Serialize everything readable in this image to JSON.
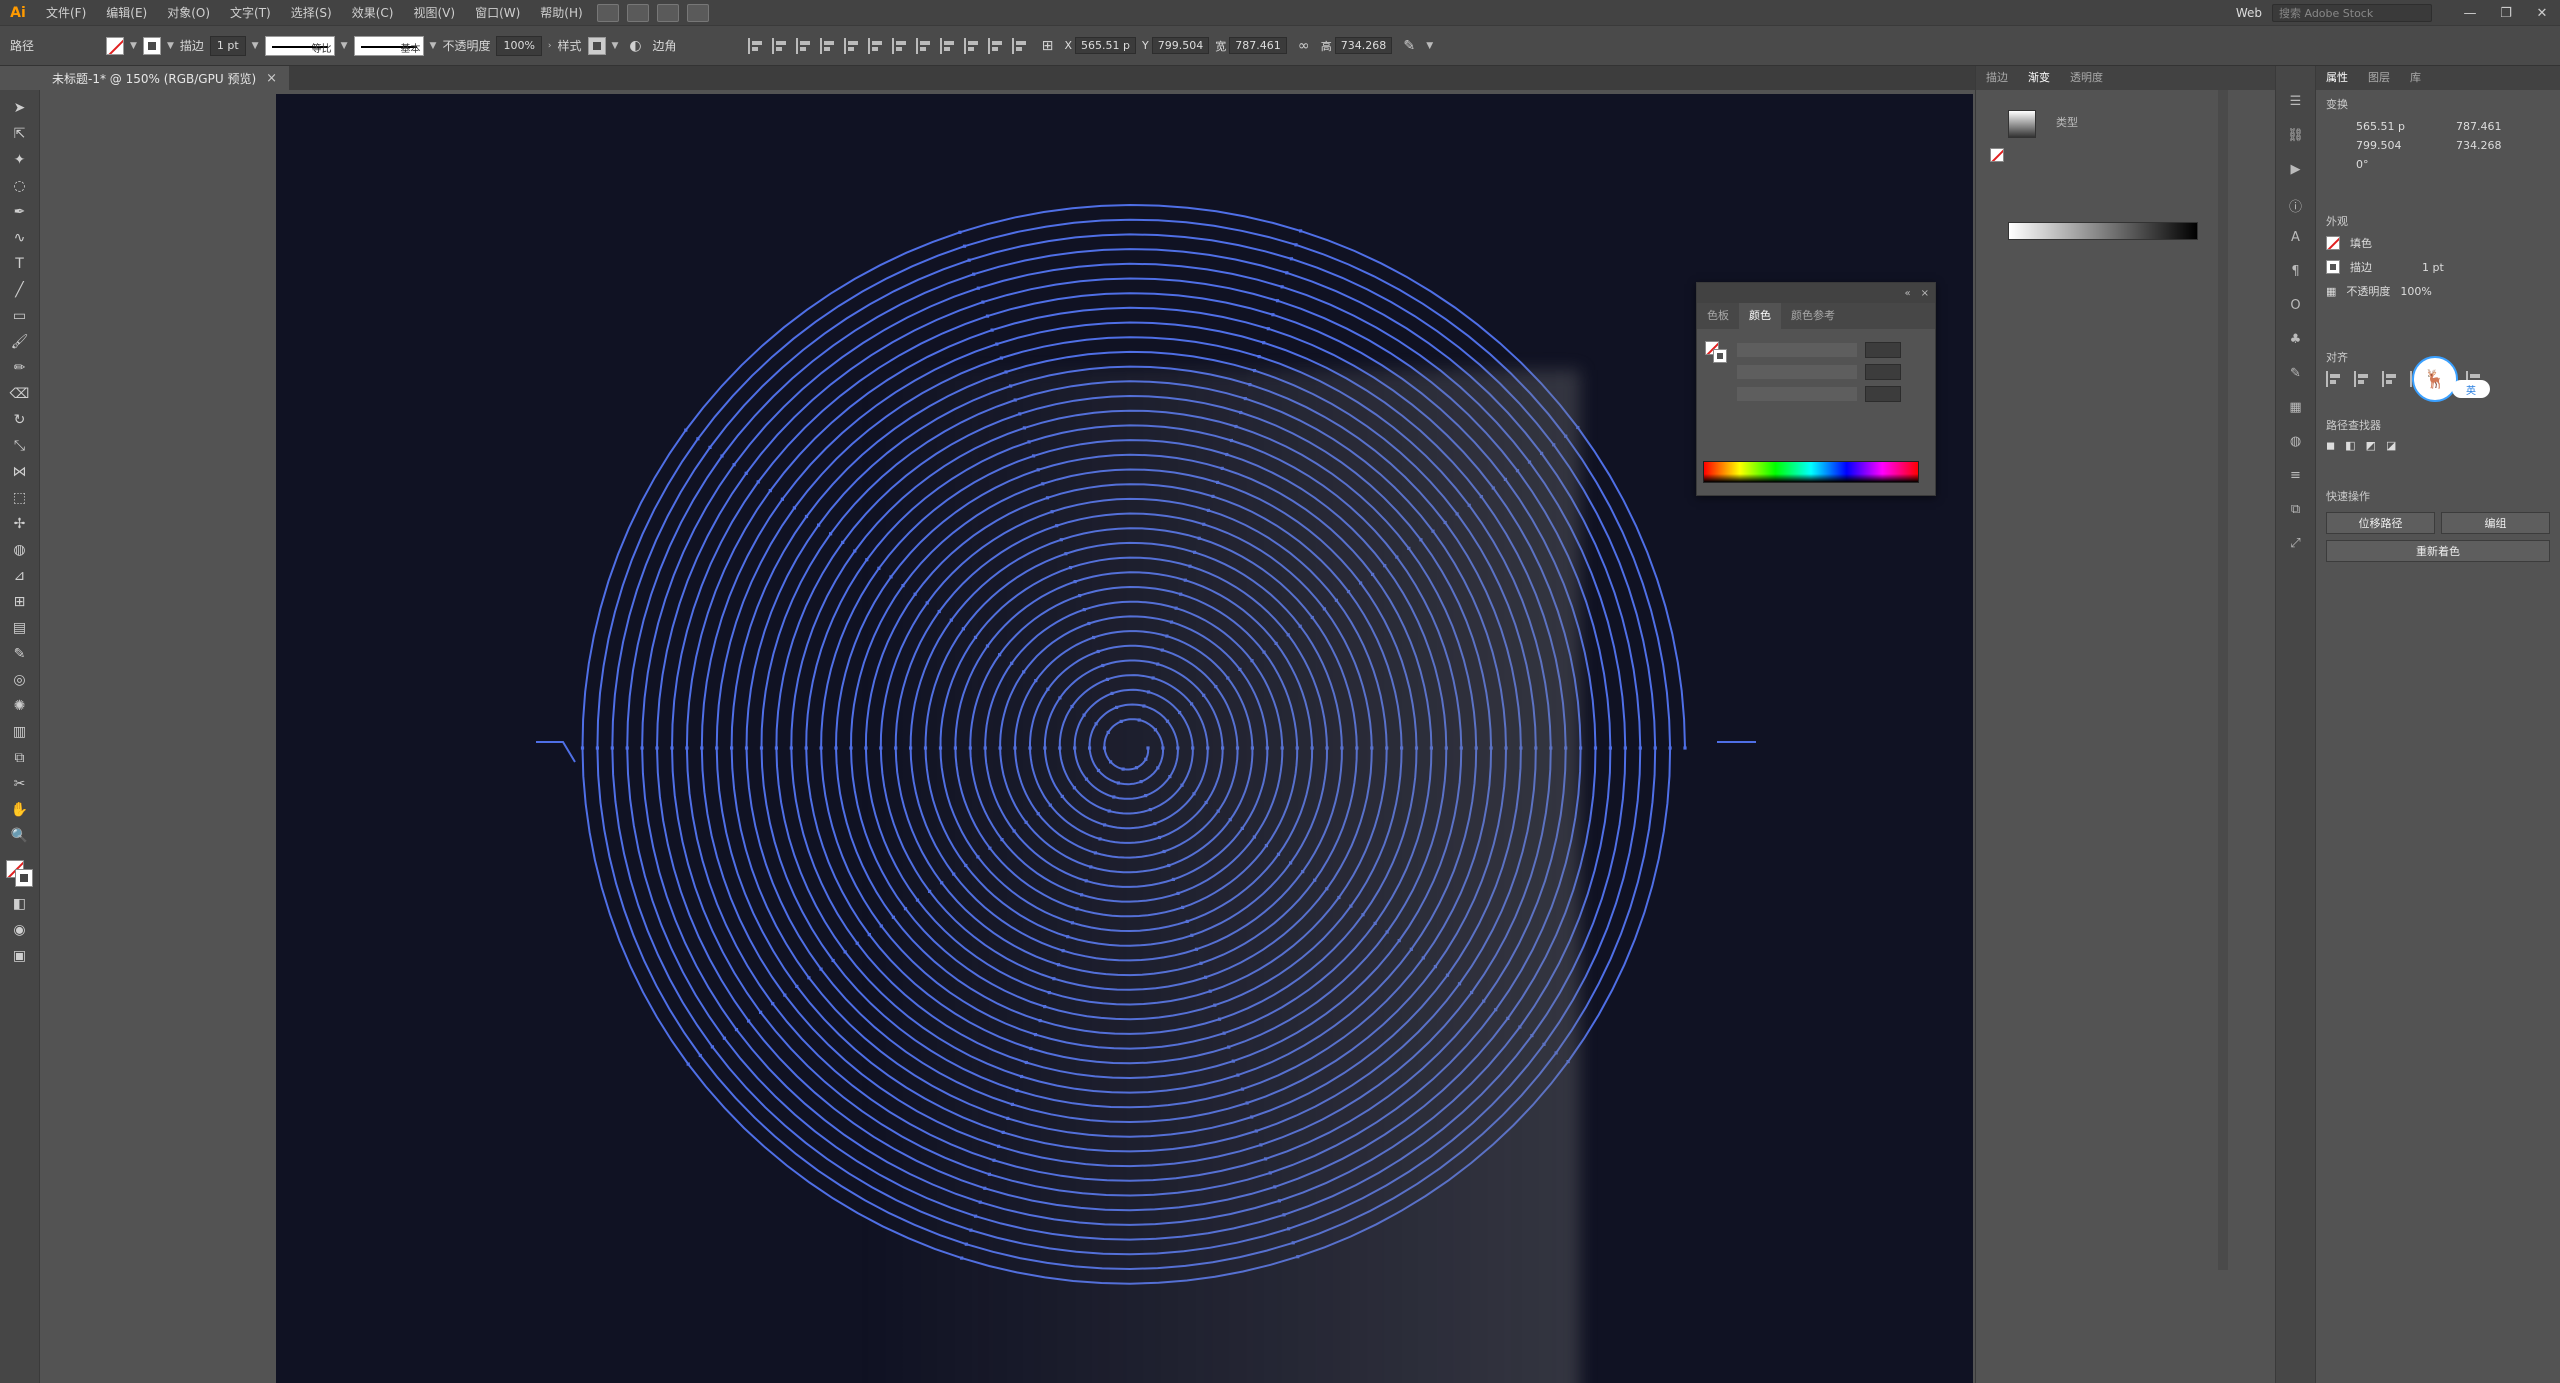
{
  "app": {
    "logo": "Ai"
  },
  "menu": {
    "items": [
      "文件(F)",
      "编辑(E)",
      "对象(O)",
      "文字(T)",
      "选择(S)",
      "效果(C)",
      "视图(V)",
      "窗口(W)",
      "帮助(H)"
    ],
    "workspace": "Web",
    "search_placeholder": "搜索 Adobe Stock"
  },
  "control_bar": {
    "path_label": "路径",
    "stroke_label": "描边",
    "stroke_weight": "1 pt",
    "profile_label": "等比",
    "brush_label": "基本",
    "opacity_label": "不透明度",
    "opacity_value": "100%",
    "style_label": "样式",
    "corner_label": "边角",
    "x_label": "X",
    "x_value": "565.51 p",
    "y_label": "Y",
    "y_value": "799.504",
    "w_label": "宽",
    "w_value": "787.461",
    "h_label": "高",
    "h_value": "734.268"
  },
  "document_tab": {
    "title": "未标题-1* @ 150% (RGB/GPU 预览)",
    "close": "×"
  },
  "color_panel": {
    "tabs": [
      "色板",
      "颜色",
      "颜色参考"
    ],
    "active_tab": "颜色",
    "header_buttons": [
      "«",
      "×"
    ]
  },
  "gradient_panel": {
    "tabs": [
      "描边",
      "渐变",
      "透明度"
    ],
    "active_tab": "渐变",
    "type_label": "类型"
  },
  "properties_panel": {
    "tabs": [
      "属性",
      "图层",
      "库"
    ],
    "active_tab": "属性",
    "transform_title": "变换",
    "x_value": "565.51 p",
    "y_value": "799.504",
    "w_value": "787.461",
    "h_value": "734.268",
    "angle_value": "0°",
    "appearance_title": "外观",
    "fill_label": "填色",
    "stroke_label": "描边",
    "stroke_weight": "1 pt",
    "opacity_label": "不透明度",
    "opacity_value": "100%",
    "align_title": "对齐",
    "pathfinder_title": "路径查找器",
    "quick_actions_title": "快速操作",
    "offset_path": "位移路径",
    "group": "编组",
    "recolor": "重新着色",
    "lang_badge": "英"
  },
  "colors": {
    "artboard": "#101223",
    "spiral": "#4f6fe6",
    "accent": "#ff9a00"
  },
  "spiral": {
    "turns": 36,
    "anchor_points": true
  }
}
